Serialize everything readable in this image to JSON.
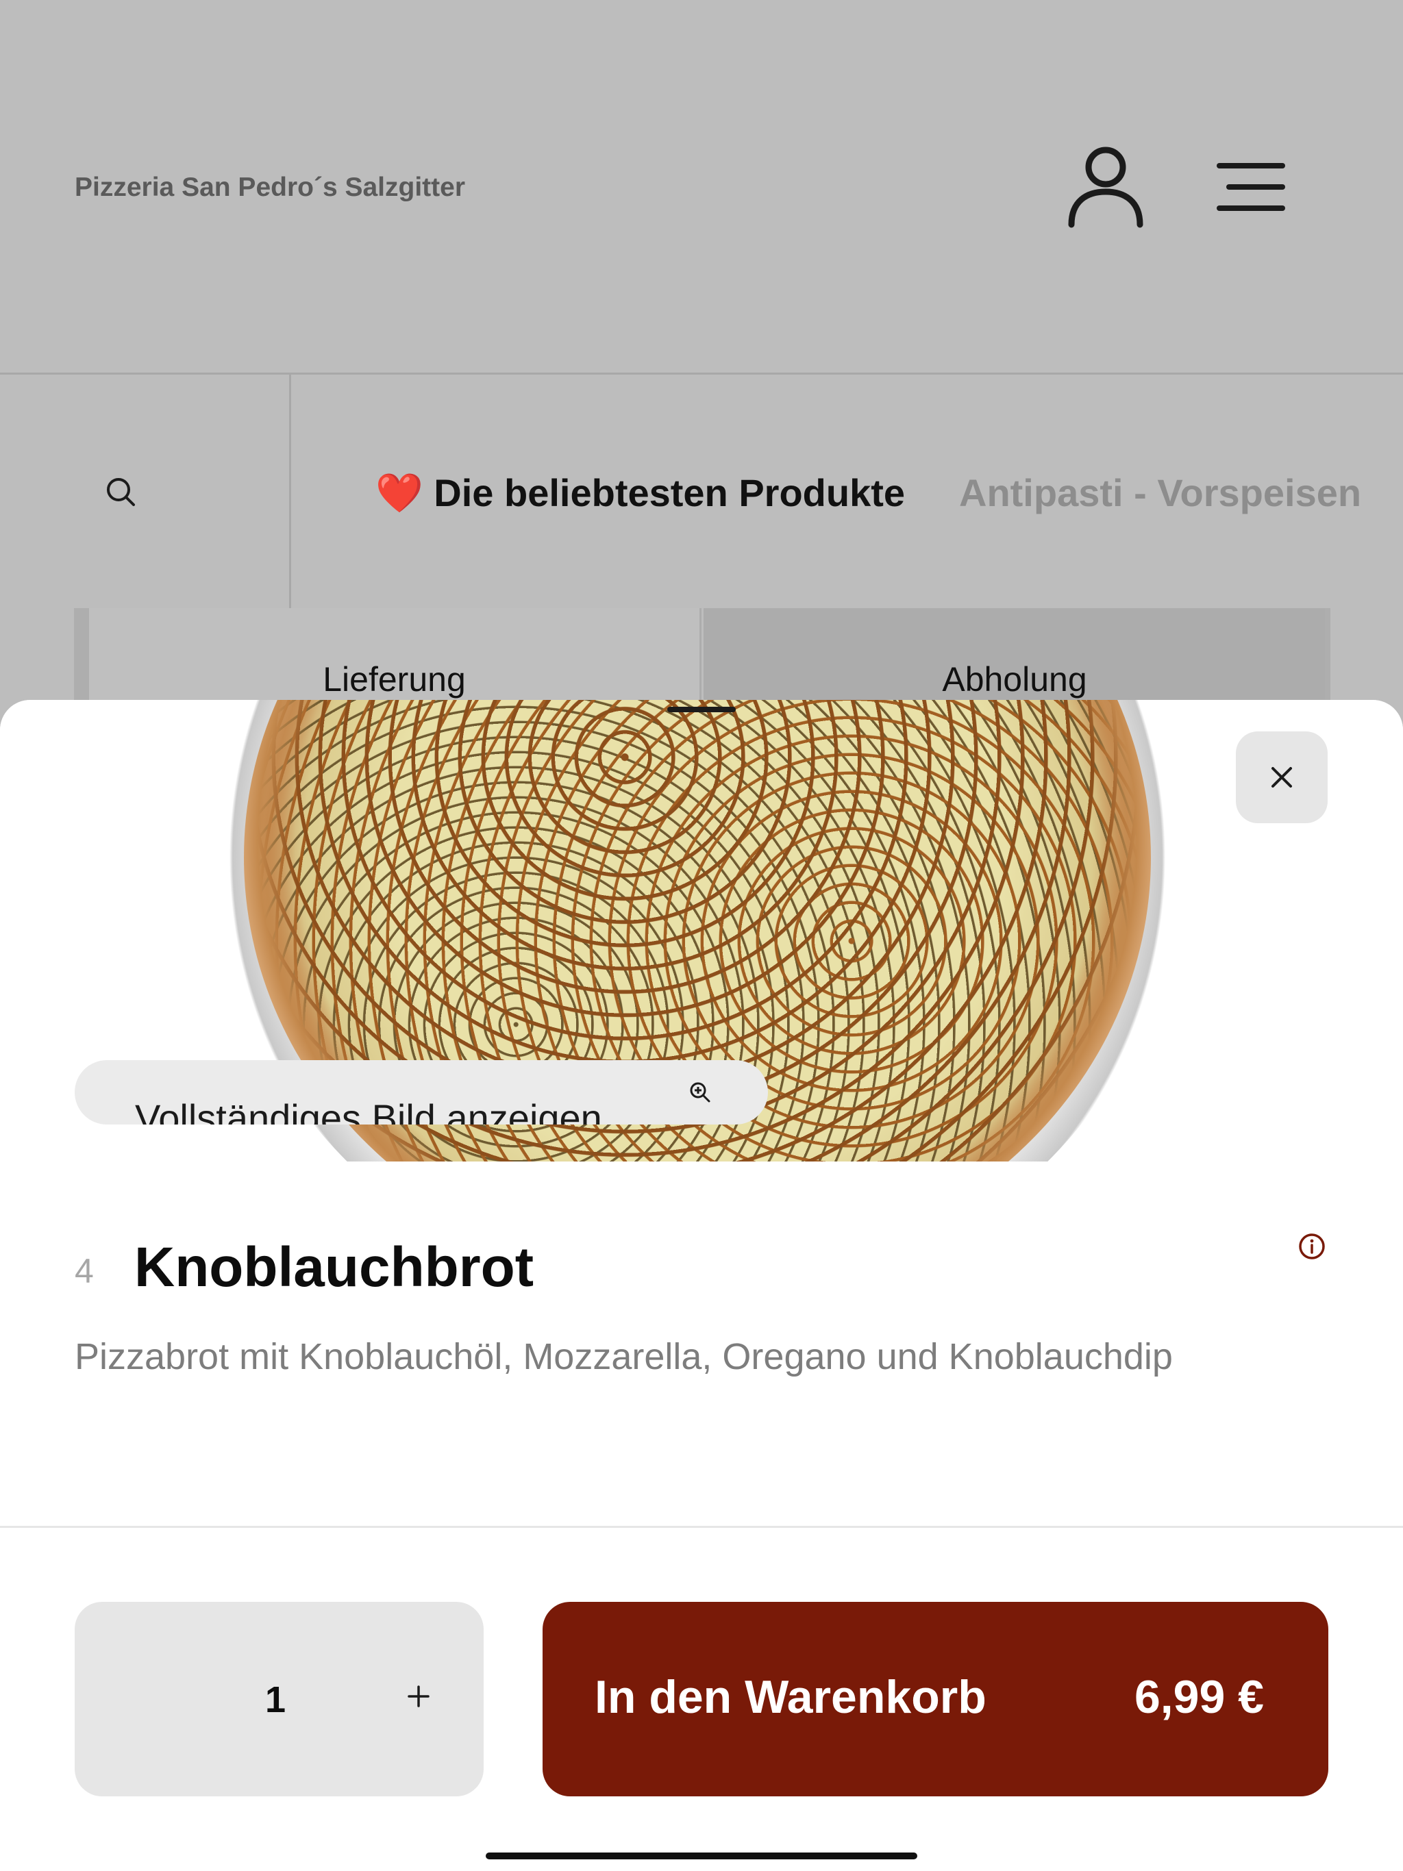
{
  "header": {
    "brand": "Pizzeria San Pedro´s Salzgitter",
    "user_icon": "user-icon",
    "menu_icon": "menu-icon"
  },
  "category_bar": {
    "search_icon": "search-icon",
    "active": {
      "emoji": "❤️",
      "label": "Die beliebtesten Produkte"
    },
    "next": "Antipasti - Vorspeisen"
  },
  "order_mode": {
    "tabs": [
      "Lieferung",
      "Abholung"
    ],
    "selected": "Abholung"
  },
  "product": {
    "number": "4",
    "name": "Knoblauchbrot",
    "description": "Pizzabrot mit Knoblauchöl, Mozzarella, Oregano und Knoblauchdip",
    "image_caption_button": "Vollständiges Bild anzeigen",
    "info_icon": "info-icon",
    "close_icon": "close-icon"
  },
  "footer": {
    "quantity": "1",
    "increment_icon": "plus-icon",
    "add_to_cart_label": "In den Warenkorb",
    "price": "6,99 €"
  },
  "colors": {
    "accent": "#791a08",
    "backdrop": "#bdbdbd",
    "pill": "#e6e6e6"
  }
}
